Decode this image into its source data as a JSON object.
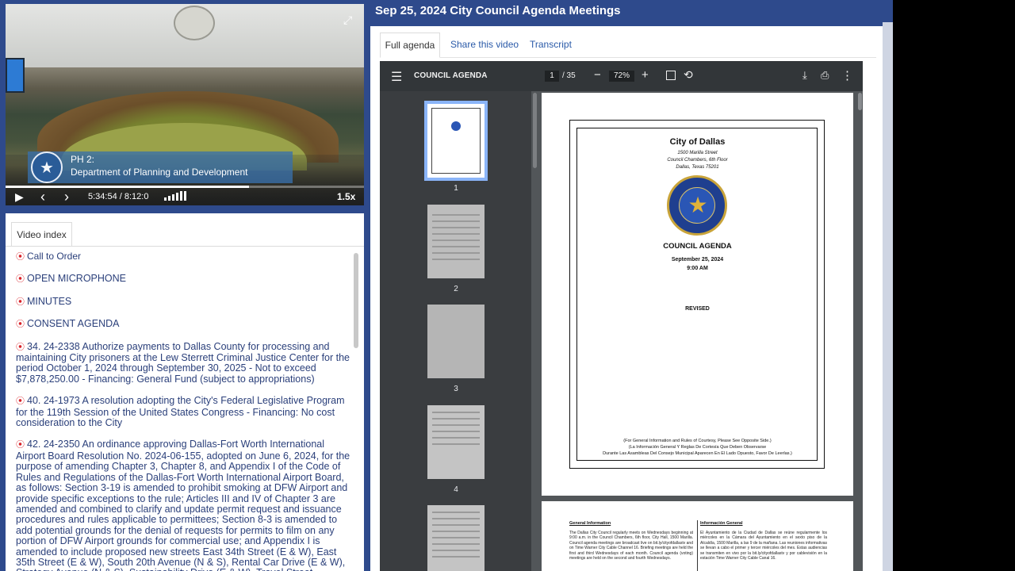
{
  "video": {
    "lower_third_line1": "PH 2:",
    "lower_third_line2": "Department of Planning and Development",
    "time": "5:34:54 / 8:12:0",
    "speed": "1.5x",
    "progress_fraction": 0.68
  },
  "video_index": {
    "tab_label": "Video index",
    "items": [
      {
        "text": "Call to Order",
        "size": "normal"
      },
      {
        "text": "OPEN MICROPHONE",
        "size": "big"
      },
      {
        "text": "MINUTES",
        "size": "big"
      },
      {
        "text": "CONSENT AGENDA",
        "size": "big"
      },
      {
        "text": "34. 24-2338 Authorize payments to Dallas County for processing and maintaining City prisoners at the Lew Sterrett Criminal Justice Center for the period October 1, 2024 through September 30, 2025 - Not to exceed $7,878,250.00 - Financing: General Fund (subject to appropriations)",
        "size": "big"
      },
      {
        "text": "40. 24-1973 A resolution adopting the City's Federal Legislative Program for the 119th Session of the United States Congress - Financing: No cost consideration to the City",
        "size": "big"
      },
      {
        "text": "42. 24-2350 An ordinance approving Dallas-Fort Worth International Airport Board Resolution No. 2024-06-155, adopted on June 6, 2024, for the purpose of amending Chapter 3, Chapter 8, and Appendix I of the Code of Rules and Regulations of the Dallas-Fort Worth International Airport Board, as follows: Section 3-19 is amended to prohibit smoking at DFW Airport and provide specific exceptions to the rule; Articles III and IV of Chapter 3 are amended and combined to clarify and update permit request and issuance procedures and rules applicable to permittees; Section 8-3 is amended to add potential grounds for the denial of requests for permits to film on any portion of DFW Airport grounds for commercial use; and Appendix I is amended to include proposed new streets East 34th Street (E & W), East 35th Street (E & W), South 20th Avenue (N & S), Rental Car Drive (E & W), Strategy Avenue (N & S), Sustainability Drive (E & W), Travel Street",
        "size": "big"
      }
    ]
  },
  "header": {
    "title": "Sep 25, 2024 City Council Agenda Meetings"
  },
  "tabs": {
    "full_agenda": "Full agenda",
    "share": "Share this video",
    "transcript": "Transcript"
  },
  "pdf": {
    "title": "COUNCIL AGENDA",
    "page_current": "1",
    "page_total": "/ 35",
    "zoom": "72%",
    "thumb_numbers": [
      "1",
      "2",
      "3",
      "4"
    ],
    "cover": {
      "city": "City of Dallas",
      "addr1": "1500 Marilla Street",
      "addr2": "Council Chambers, 6th Floor",
      "addr3": "Dallas, Texas 75201",
      "heading": "COUNCIL AGENDA",
      "date": "September 25, 2024",
      "time": "9:00 AM",
      "revised": "REVISED",
      "note1": "(For General Information and Rules of Courtesy, Please See Opposite Side.)",
      "note2": "(La Información General Y Reglas De Cortesía Que Deben Observarse",
      "note3": "Durante Las Asambleas Del Consejo Municipal Aparecen En El Lado Opuesto, Favor De Leerlas.)"
    },
    "page2": {
      "left_heading": "General Information",
      "right_heading": "Información General",
      "left_text": "The Dallas City Council regularly meets on Wednesdays beginning at 9:00 a.m. in the Council Chambers, 6th floor, City Hall, 1500 Marilla. Council agenda meetings are broadcast live on bit.ly/cityofdallastv and on Time Warner City Cable Channel 16. Briefing meetings are held the first and third Wednesdays of each month. Council agenda (voting) meetings are held on the second and fourth Wednesdays.",
      "right_text": "El Ayuntamiento de la Ciudad de Dallas se reúne regularmente los miércoles en la Cámara del Ayuntamiento en el sexto piso de la Alcaldía, 1500 Marilla, a las 9 de la mañana. Las reuniones informativas se llevan a cabo el primer y tercer miércoles del mes. Estas audiencias se transmiten en vivo por la bit.ly/cityofdallastv y por cablevisión en la estación Time Warner City Cable Canal 16."
    }
  },
  "colors": {
    "header_bg": "#2e4a8c",
    "link": "#2a3f7a",
    "play_marker": "#d8232a",
    "pdf_toolbar": "#323639"
  }
}
